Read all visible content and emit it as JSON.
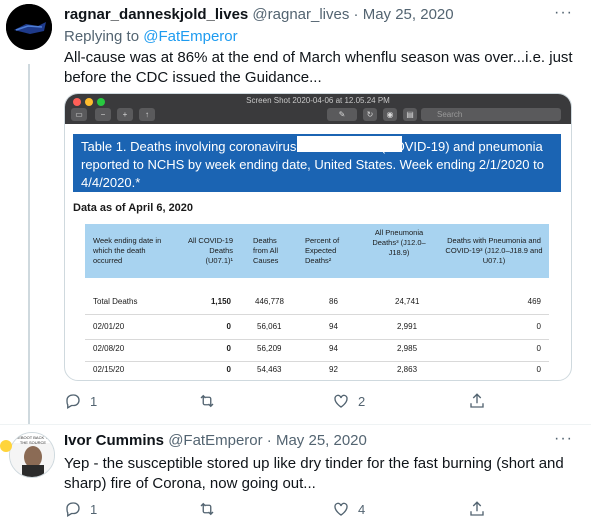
{
  "tweet1": {
    "name": "ragnar_danneskjold_lives",
    "handle": "@ragnar_lives",
    "dot": "·",
    "date": "May 25, 2020",
    "replying_prefix": "Replying to",
    "replying_mention": "@FatEmperor",
    "text": "All-cause was at 86% at the end of March whenflu season was over...i.e. just before the CDC issued the Guidance...",
    "replies": "1",
    "likes": "2",
    "more": "···"
  },
  "screenshot": {
    "window_title": "Screen Shot 2020-04-06 at 12.05.24 PM",
    "search_placeholder": "Search",
    "banner": "Table 1. Deaths involving coronavirus disease 2019 (COVID-19) and pneumonia reported to NCHS by week ending date, United States. Week ending 2/1/2020 to 4/4/2020.*",
    "as_of": "Data as of April 6, 2020",
    "headers": [
      "Week ending date in which the death occurred",
      "All COVID-19 Deaths (U07.1)¹",
      "Deaths from All Causes",
      "Percent of Expected Deaths²",
      "All Pneumonia Deaths³ (J12.0–J18.9)",
      "Deaths with Pneumonia and COVID-19³ (J12.0–J18.9 and U07.1)"
    ],
    "rows": [
      [
        "Total Deaths",
        "1,150",
        "446,778",
        "86",
        "24,741",
        "469"
      ],
      [
        "02/01/20",
        "0",
        "56,061",
        "94",
        "2,991",
        "0"
      ],
      [
        "02/08/20",
        "0",
        "56,209",
        "94",
        "2,985",
        "0"
      ],
      [
        "02/15/20",
        "0",
        "54,463",
        "92",
        "2,863",
        "0"
      ]
    ]
  },
  "tweet2": {
    "name": "Ivor Cummins",
    "handle": "@FatEmperor",
    "dot": "·",
    "date": "May 25, 2020",
    "text": "Yep - the susceptible stored up like dry tinder for the fast burning (short and sharp) fire of Corona, now going out...",
    "replies": "1",
    "likes": "4",
    "more": "···",
    "avatar_caption": "REBOOT BACK TO THE SOURCE"
  },
  "colors": {
    "accent": "#1d9bf0",
    "muted": "#536471",
    "banner_blue": "#1b64b3",
    "table_header": "#a8d3f0"
  }
}
